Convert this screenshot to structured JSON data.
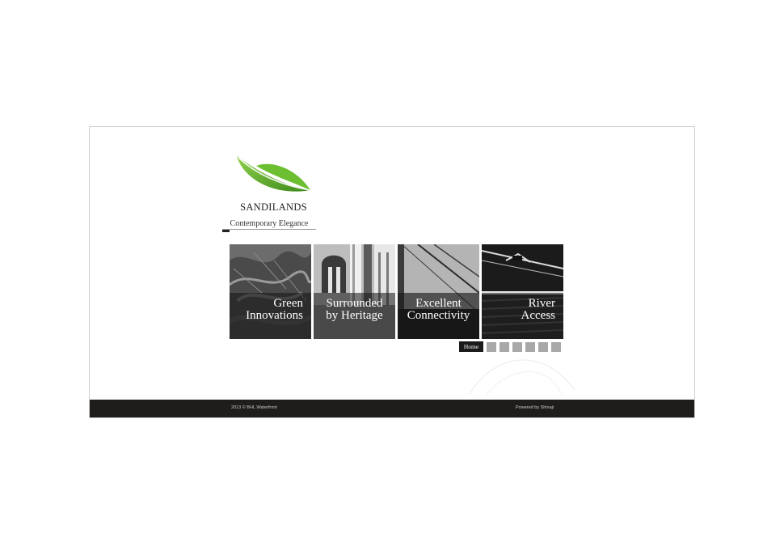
{
  "logo": {
    "brand_name": "SANDILANDS",
    "tagline": "Contemporary Elegance",
    "leaf_color": "#5fae2a"
  },
  "tiles": [
    {
      "caption": "Green Innovations",
      "line1": "Green",
      "line2": "Innovations"
    },
    {
      "caption": "Surrounded by Heritage",
      "line1": "Surrounded",
      "line2": "by Heritage"
    },
    {
      "caption": "Excellent Connectivity",
      "line1": "Excellent",
      "line2": "Connectivity"
    },
    {
      "caption": "River Access",
      "line1": "River",
      "line2": "Access"
    }
  ],
  "nav": {
    "home_label": "Home",
    "dot_count": 6,
    "dot_color": "#a8a8a8"
  },
  "footer": {
    "copyright": "2013 © BHL Waterfront",
    "powered_by": "Powered by Shinaji",
    "background": "#1f1c1c"
  }
}
